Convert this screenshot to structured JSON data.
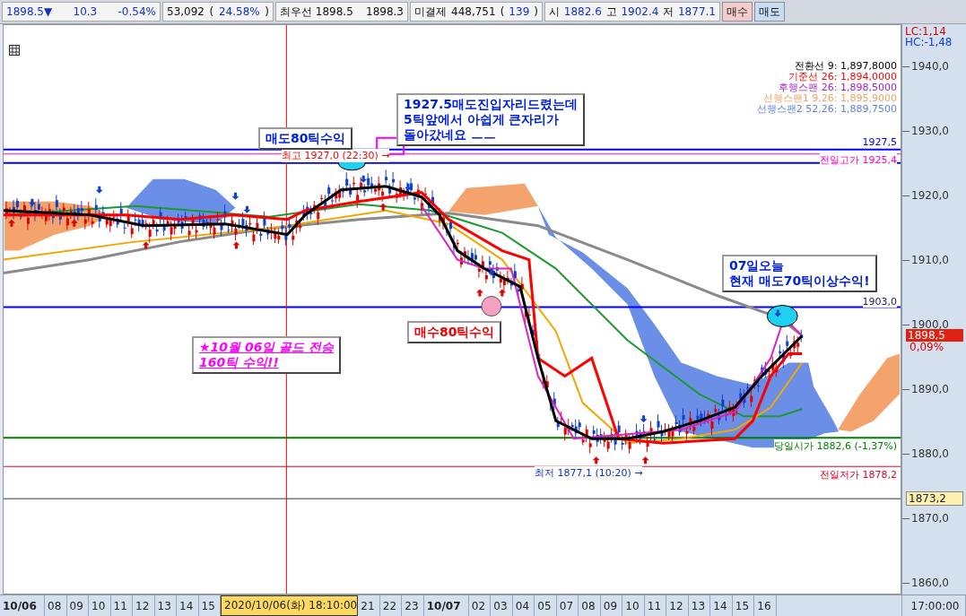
{
  "quote_bar": {
    "cells": [
      {
        "items": [
          {
            "text": "1898.5▼",
            "kind": "value"
          },
          {
            "text": "10.3",
            "kind": "value"
          },
          {
            "text": "-0.54%",
            "kind": "value"
          }
        ]
      },
      {
        "items": [
          {
            "text": "53,092",
            "kind": "label"
          },
          {
            "text": "(",
            "kind": "label"
          },
          {
            "text": "24.58%",
            "kind": "value"
          },
          {
            "text": ")",
            "kind": "label"
          }
        ]
      },
      {
        "items": [
          {
            "text": "최우선 1898.5",
            "kind": "label"
          },
          {
            "text": "1898.3",
            "kind": "label"
          }
        ]
      },
      {
        "items": [
          {
            "text": "미결제",
            "kind": "label"
          },
          {
            "text": "448,751",
            "kind": "label"
          },
          {
            "text": "(",
            "kind": "label"
          },
          {
            "text": "139",
            "kind": "value"
          },
          {
            "text": ")",
            "kind": "label"
          }
        ]
      },
      {
        "items": [
          {
            "text": "시",
            "kind": "label"
          },
          {
            "text": "1882.6",
            "kind": "value"
          },
          {
            "text": "고",
            "kind": "label"
          },
          {
            "text": "1902.4",
            "kind": "value"
          },
          {
            "text": "저",
            "kind": "label"
          },
          {
            "text": "1877.1",
            "kind": "value"
          }
        ]
      }
    ],
    "buttons": [
      {
        "label": "매수",
        "kind": "buy"
      },
      {
        "label": "매도",
        "kind": "sell"
      }
    ]
  },
  "chart": {
    "indicators": {
      "lc": "LC:1,14",
      "hc": "HC:-1,48"
    },
    "legend": [
      {
        "text": "전환선 9: 1,897,8000",
        "color": "#000000"
      },
      {
        "text": "기준선 26: 1,894,0000",
        "color": "#ff0000"
      },
      {
        "text": "후행스팬 26: 1,898,5000",
        "color": "#a020d0"
      },
      {
        "text": "선행스팬1 9,26: 1,895,9000",
        "color": "#f4a060"
      },
      {
        "text": "선행스팬2 52,26: 1,889,7500",
        "color": "#6080e0"
      }
    ],
    "y_ticks": [
      "1940,0",
      "1930,0",
      "1920,0",
      "1910,0",
      "1900,0",
      "1890,0",
      "1880,0",
      "1870,0",
      "1860,0"
    ],
    "current_price": "1898,5",
    "change": "0,09%",
    "marker_price": "1873,2",
    "price_labels": [
      {
        "text": "1927,5",
        "kind": "level"
      },
      {
        "text": "전일고가 1925,4",
        "kind": "prev_high"
      },
      {
        "text": "1903,0",
        "kind": "line"
      },
      {
        "text": "당일시가 1882,6 (-1,37%)",
        "kind": "open"
      },
      {
        "text": "전일저가 1878,2",
        "kind": "prev_low"
      }
    ],
    "extremes": [
      {
        "text": "최고 1927,0 (22:30) →",
        "kind": "high"
      },
      {
        "text": "최저 1877,1 (10:20) →",
        "kind": "low"
      }
    ],
    "annotations": [
      {
        "kind": "sell",
        "lines": [
          "매도80틱수익"
        ]
      },
      {
        "kind": "note",
        "lines": [
          "1927.5매도진입자리드렸는데",
          "5틱앞에서 아쉽게 큰자리가",
          "돌아갔네요 ㅡㅡ"
        ]
      },
      {
        "kind": "buy",
        "lines": [
          "매수80틱수익"
        ]
      },
      {
        "kind": "promo",
        "lines": [
          "★10월 06일 골드 전승",
          "160틱 수익!!"
        ]
      },
      {
        "kind": "note",
        "lines": [
          "07일오늘",
          "현재 매도70틱이상수익!"
        ]
      }
    ]
  },
  "time_axis": {
    "labels": [
      {
        "text": "10/06",
        "kind": "date"
      },
      {
        "text": "08",
        "kind": "hour"
      },
      {
        "text": "09",
        "kind": "hour"
      },
      {
        "text": "10",
        "kind": "hour"
      },
      {
        "text": "11",
        "kind": "hour"
      },
      {
        "text": "12",
        "kind": "hour"
      },
      {
        "text": "13",
        "kind": "hour"
      },
      {
        "text": "14",
        "kind": "hour"
      },
      {
        "text": "15",
        "kind": "hour"
      },
      {
        "text": "2020/10/06(화) 18:10:00",
        "kind": "cursor"
      },
      {
        "text": "21",
        "kind": "hour"
      },
      {
        "text": "22",
        "kind": "hour"
      },
      {
        "text": "23",
        "kind": "hour"
      },
      {
        "text": "10/07",
        "kind": "date"
      },
      {
        "text": "02",
        "kind": "hour"
      },
      {
        "text": "03",
        "kind": "hour"
      },
      {
        "text": "04",
        "kind": "hour"
      },
      {
        "text": "05",
        "kind": "hour"
      },
      {
        "text": "07",
        "kind": "hour"
      },
      {
        "text": "08",
        "kind": "hour"
      },
      {
        "text": "09",
        "kind": "hour"
      },
      {
        "text": "10",
        "kind": "hour"
      },
      {
        "text": "11",
        "kind": "hour"
      },
      {
        "text": "12",
        "kind": "hour"
      },
      {
        "text": "13",
        "kind": "hour"
      },
      {
        "text": "14",
        "kind": "hour"
      },
      {
        "text": "15",
        "kind": "hour"
      },
      {
        "text": "16",
        "kind": "hour"
      }
    ],
    "end": "17:00:00"
  }
}
